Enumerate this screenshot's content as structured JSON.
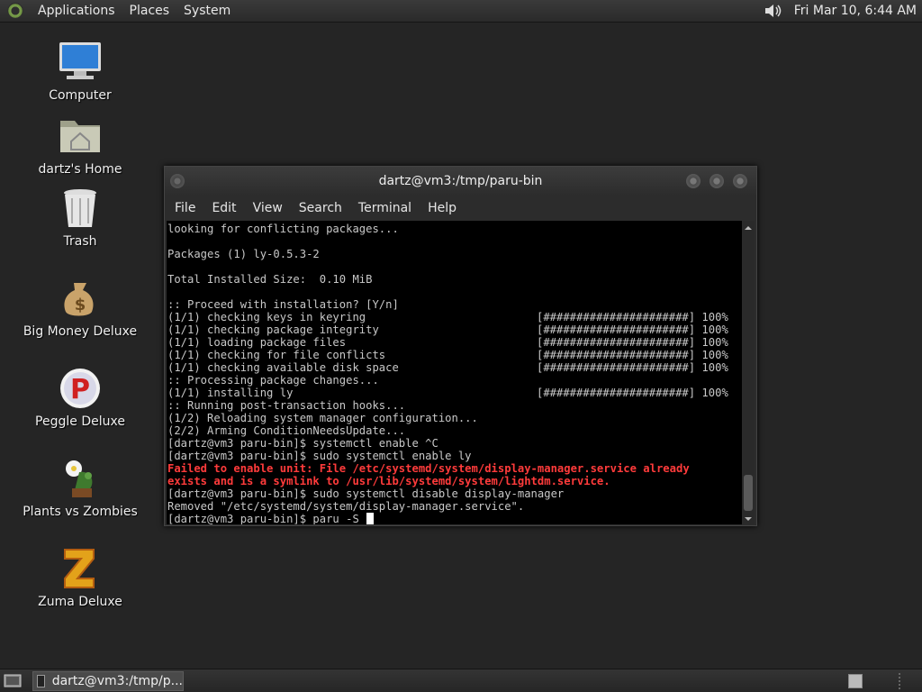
{
  "top_panel": {
    "menus": [
      "Applications",
      "Places",
      "System"
    ],
    "clock": "Fri Mar 10,  6:44 AM",
    "icons": {
      "menu_logo": "distro-logo-icon",
      "volume": "speaker-icon"
    }
  },
  "desktop": {
    "icons": [
      {
        "label": "Computer",
        "icon": "computer-icon"
      },
      {
        "label": "dartz's Home",
        "icon": "home-folder-icon"
      },
      {
        "label": "Trash",
        "icon": "trash-icon"
      },
      {
        "label": "Big Money Deluxe",
        "icon": "money-bag-icon"
      },
      {
        "label": "Peggle Deluxe",
        "icon": "peggle-icon"
      },
      {
        "label": "Plants vs Zombies",
        "icon": "plants-vs-zombies-icon"
      },
      {
        "label": "Zuma Deluxe",
        "icon": "zuma-icon"
      }
    ]
  },
  "terminal": {
    "title": "dartz@vm3:/tmp/paru-bin",
    "menu": [
      "File",
      "Edit",
      "View",
      "Search",
      "Terminal",
      "Help"
    ],
    "lines": [
      {
        "text": "looking for conflicting packages...",
        "bar": ""
      },
      {
        "text": "",
        "bar": ""
      },
      {
        "text": "Packages (1) ly-0.5.3-2",
        "bar": ""
      },
      {
        "text": "",
        "bar": ""
      },
      {
        "text": "Total Installed Size:  0.10 MiB",
        "bar": ""
      },
      {
        "text": "",
        "bar": ""
      },
      {
        "text": ":: Proceed with installation? [Y/n]",
        "bar": ""
      },
      {
        "text": "(1/1) checking keys in keyring",
        "bar": "[######################] 100%"
      },
      {
        "text": "(1/1) checking package integrity",
        "bar": "[######################] 100%"
      },
      {
        "text": "(1/1) loading package files",
        "bar": "[######################] 100%"
      },
      {
        "text": "(1/1) checking for file conflicts",
        "bar": "[######################] 100%"
      },
      {
        "text": "(1/1) checking available disk space",
        "bar": "[######################] 100%"
      },
      {
        "text": ":: Processing package changes...",
        "bar": ""
      },
      {
        "text": "(1/1) installing ly",
        "bar": "[######################] 100%"
      },
      {
        "text": ":: Running post-transaction hooks...",
        "bar": ""
      },
      {
        "text": "(1/2) Reloading system manager configuration...",
        "bar": ""
      },
      {
        "text": "(2/2) Arming ConditionNeedsUpdate...",
        "bar": ""
      },
      {
        "text": "[dartz@vm3 paru-bin]$ systemctl enable ^C",
        "bar": ""
      },
      {
        "text": "[dartz@vm3 paru-bin]$ sudo systemctl enable ly",
        "bar": ""
      },
      {
        "text": "Failed to enable unit: File /etc/systemd/system/display-manager.service already",
        "bar": "",
        "error": true
      },
      {
        "text": "exists and is a symlink to /usr/lib/systemd/system/lightdm.service.",
        "bar": "",
        "error": true
      },
      {
        "text": "[dartz@vm3 paru-bin]$ sudo systemctl disable display-manager",
        "bar": ""
      },
      {
        "text": "Removed \"/etc/systemd/system/display-manager.service\".",
        "bar": ""
      },
      {
        "text": "[dartz@vm3 paru-bin]$ paru -S ",
        "bar": "",
        "cursor": true
      }
    ],
    "error_color": "#ff3b3b"
  },
  "bottom_panel": {
    "task": "dartz@vm3:/tmp/p...",
    "icons": {
      "show_desktop": "show-desktop-icon",
      "task": "terminal-icon",
      "workspace": "workspace-switcher-icon"
    }
  }
}
